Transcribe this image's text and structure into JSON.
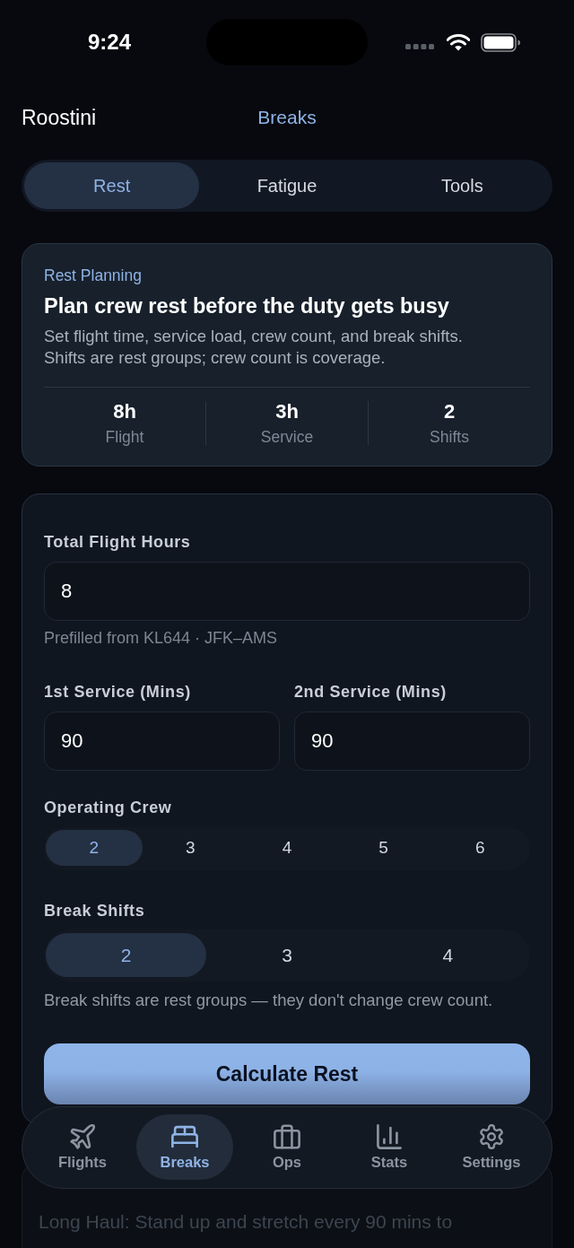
{
  "status_bar": {
    "time": "9:24"
  },
  "header": {
    "app_name": "Roostini",
    "title": "Breaks"
  },
  "tabs": [
    {
      "label": "Rest",
      "selected": true
    },
    {
      "label": "Fatigue",
      "selected": false
    },
    {
      "label": "Tools",
      "selected": false
    }
  ],
  "summary_card": {
    "eyebrow": "Rest Planning",
    "title": "Plan crew rest before the duty gets busy",
    "description": "Set flight time, service load, crew count, and break shifts. Shifts are rest groups; crew count is coverage.",
    "stats": [
      {
        "value": "8h",
        "label": "Flight"
      },
      {
        "value": "3h",
        "label": "Service"
      },
      {
        "value": "2",
        "label": "Shifts"
      }
    ]
  },
  "form": {
    "flight_hours": {
      "label": "Total Flight Hours",
      "value": "8",
      "hint": "Prefilled from KL644 · JFK–AMS"
    },
    "services": [
      {
        "label": "1st Service (Mins)",
        "value": "90"
      },
      {
        "label": "2nd Service (Mins)",
        "value": "90"
      }
    ],
    "operating_crew": {
      "label": "Operating Crew",
      "options": [
        {
          "label": "2",
          "selected": true
        },
        {
          "label": "3",
          "selected": false
        },
        {
          "label": "4",
          "selected": false
        },
        {
          "label": "5",
          "selected": false
        },
        {
          "label": "6",
          "selected": false
        }
      ]
    },
    "break_shifts": {
      "label": "Break Shifts",
      "options": [
        {
          "label": "2",
          "selected": true
        },
        {
          "label": "3",
          "selected": false
        },
        {
          "label": "4",
          "selected": false
        }
      ],
      "note": "Break shifts are rest groups — they don't change crew count."
    },
    "submit_button": "Calculate Rest"
  },
  "tip_card": {
    "text": "Long Haul: Stand up and stretch every 90 mins to"
  },
  "bottom_nav": [
    {
      "label": "Flights",
      "kind": "plane",
      "selected": false
    },
    {
      "label": "Breaks",
      "kind": "bed",
      "selected": true
    },
    {
      "label": "Ops",
      "kind": "briefcase",
      "selected": false
    },
    {
      "label": "Stats",
      "kind": "chart",
      "selected": false
    },
    {
      "label": "Settings",
      "kind": "gear",
      "selected": false
    }
  ]
}
